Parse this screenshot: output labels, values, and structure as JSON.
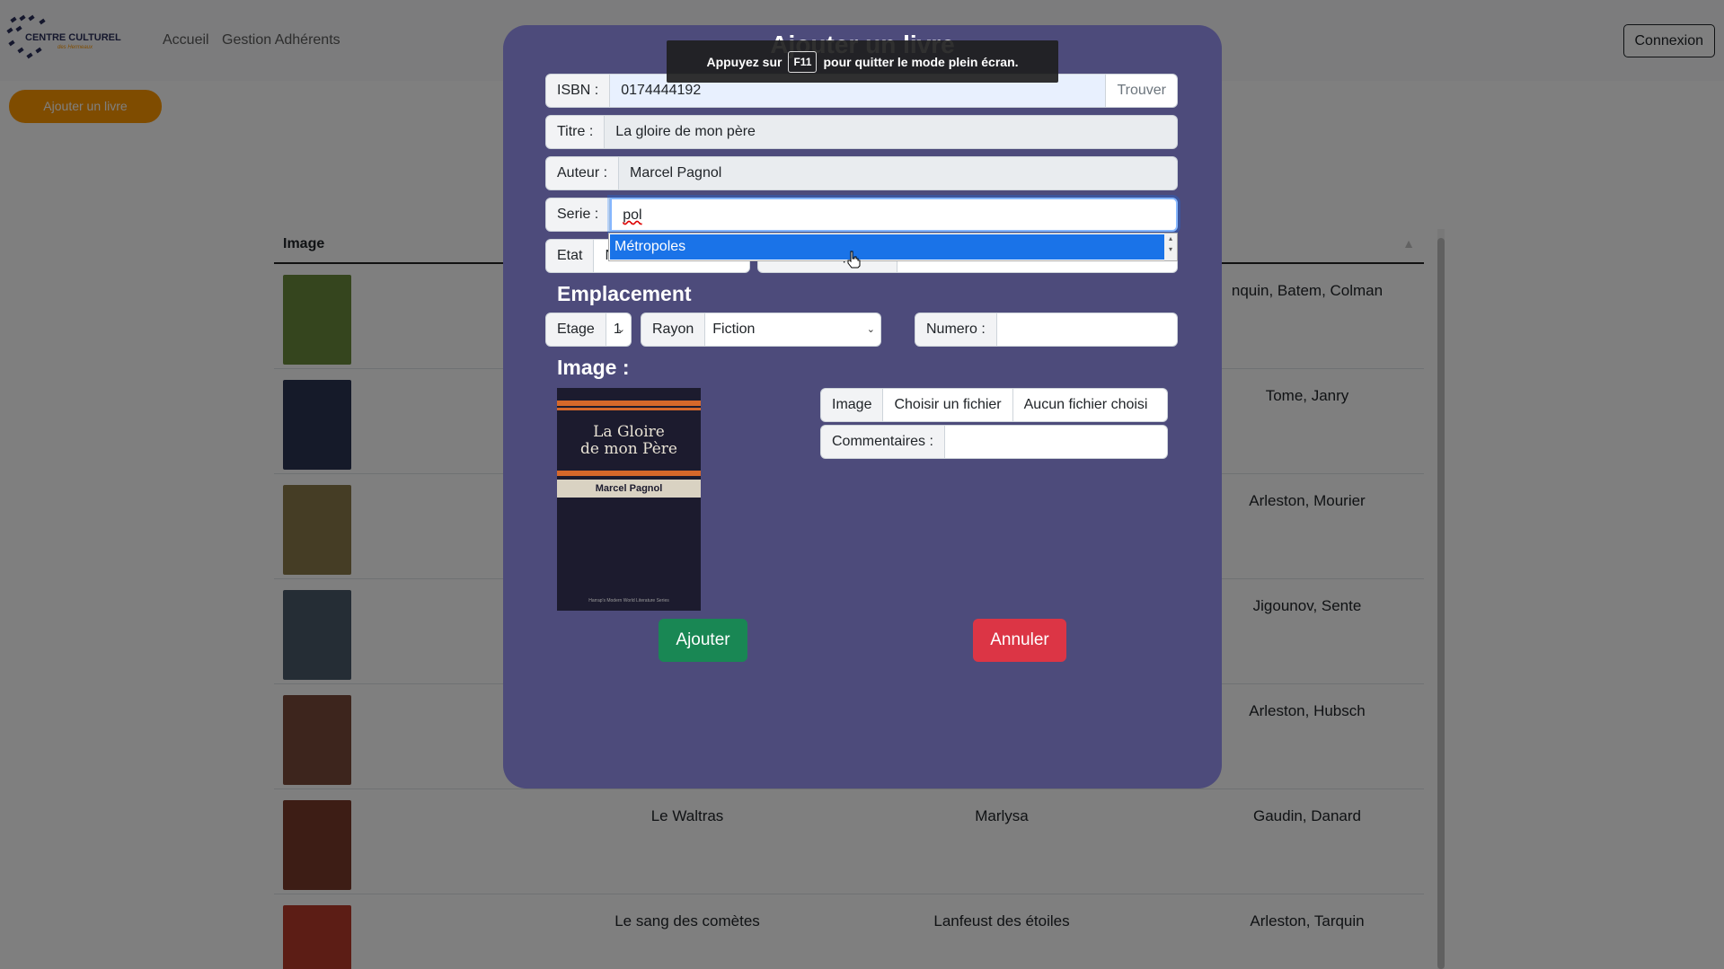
{
  "navbar": {
    "logo_text": "CENTRE CULTUREL",
    "logo_subtext": "des Hermeaux",
    "links": [
      "Accueil",
      "Gestion Adhérents"
    ],
    "login_label": "Connexion"
  },
  "add_book_label": "Ajouter un livre",
  "table": {
    "header_image": "Image",
    "rows": [
      {
        "title": "",
        "serie": "",
        "authors": "nquin, Batem, Colman",
        "cover_color": "#6a8a3c"
      },
      {
        "title": "",
        "serie": "",
        "authors": "Tome, Janry",
        "cover_color": "#2b3552"
      },
      {
        "title": "",
        "serie": "",
        "authors": "Arleston, Mourier",
        "cover_color": "#8a7a4a"
      },
      {
        "title": "",
        "serie": "",
        "authors": "Jigounov, Sente",
        "cover_color": "#4b5a6b"
      },
      {
        "title": "",
        "serie": "",
        "authors": "Arleston, Hubsch",
        "cover_color": "#7a4a3a"
      },
      {
        "title": "Le Waltras",
        "serie": "Marlysa",
        "authors": "Gaudin, Danard",
        "cover_color": "#7a3a2a"
      },
      {
        "title": "Le sang des comètes",
        "serie": "Lanfeust des étoiles",
        "authors": "Arleston, Tarquin",
        "cover_color": "#b83a2a"
      }
    ]
  },
  "modal": {
    "title": "Ajouter un livre",
    "isbn": {
      "label": "ISBN :",
      "value": "0174444192",
      "button": "Trouver"
    },
    "titre": {
      "label": "Titre :",
      "value": "La gloire de mon père"
    },
    "auteur": {
      "label": "Auteur :",
      "value": "Marcel Pagnol"
    },
    "serie": {
      "label": "Serie :",
      "value": "pol"
    },
    "serie_suggestion": "Métropoles",
    "etat": {
      "label": "Etat",
      "value": "Neuf"
    },
    "hidden_field_label": "Code exemplaire :",
    "emplacement_title": "Emplacement",
    "etage": {
      "label": "Etage",
      "value": "1"
    },
    "rayon": {
      "label": "Rayon",
      "value": "Fiction"
    },
    "numero": {
      "label": "Numero :",
      "value": ""
    },
    "image_title": "Image :",
    "cover": {
      "title_line1": "La Gloire",
      "title_line2": "de mon Père",
      "author": "Marcel Pagnol",
      "footer": "Harrap's Modern World Literature Series"
    },
    "file": {
      "label": "Image",
      "button": "Choisir un fichier",
      "status": "Aucun fichier choisi"
    },
    "commentaires": {
      "label": "Commentaires :",
      "value": ""
    },
    "submit_label": "Ajouter",
    "cancel_label": "Annuler"
  },
  "fullscreen_toast": {
    "before": "Appuyez sur",
    "key": "F11",
    "after": "pour quitter le mode plein écran."
  },
  "colors": {
    "modal_bg": "#4d4b7b",
    "submit": "#198754",
    "cancel": "#dc3545",
    "add_book": "#ff9800",
    "selection": "#1a73e8"
  }
}
